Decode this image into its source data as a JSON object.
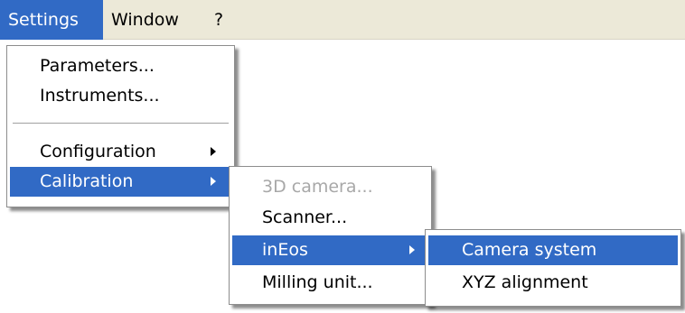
{
  "menubar": {
    "items": [
      {
        "label": "Settings"
      },
      {
        "label": "Window"
      },
      {
        "label": "?"
      }
    ]
  },
  "settings_menu": {
    "items": [
      {
        "label": "Parameters..."
      },
      {
        "label": "Instruments..."
      },
      {
        "label": "Configuration"
      },
      {
        "label": "Calibration"
      }
    ]
  },
  "calibration_menu": {
    "items": [
      {
        "label": "3D camera..."
      },
      {
        "label": "Scanner..."
      },
      {
        "label": "inEos"
      },
      {
        "label": "Milling unit..."
      }
    ]
  },
  "ineos_menu": {
    "items": [
      {
        "label": "Camera system"
      },
      {
        "label": "XYZ alignment"
      }
    ]
  },
  "colors": {
    "menubar_background": "#ece9d8",
    "highlight": "#316ac5",
    "highlight_text": "#ffffff",
    "disabled_text": "#a8a8a8"
  }
}
